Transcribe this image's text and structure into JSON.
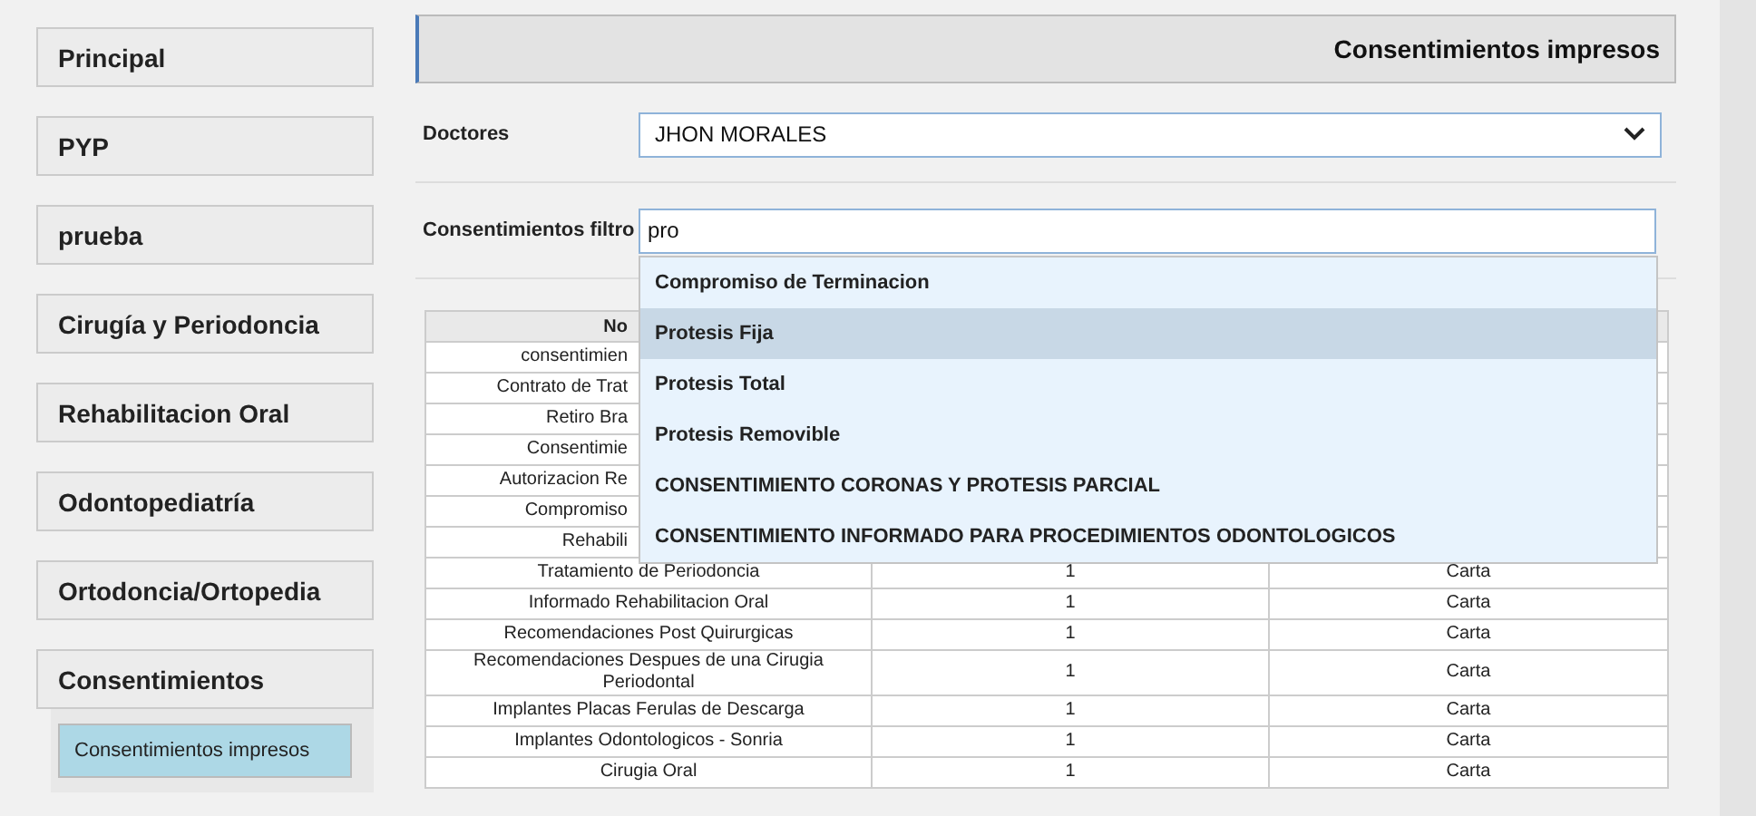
{
  "sidebar": {
    "items": [
      {
        "label": "Principal",
        "selected": false
      },
      {
        "label": "PYP",
        "selected": false
      },
      {
        "label": "prueba",
        "selected": false
      },
      {
        "label": "Cirugía y Periodoncia",
        "selected": false
      },
      {
        "label": "Rehabilitacion Oral",
        "selected": false
      },
      {
        "label": "Odontopediatría",
        "selected": false
      },
      {
        "label": "Ortodoncia/Ortopedia",
        "selected": false
      },
      {
        "label": "Consentimientos",
        "selected": false
      }
    ],
    "subitems": [
      {
        "label": "Consentimientos impresos",
        "selected": true
      }
    ]
  },
  "header": {
    "title": "Consentimientos impresos"
  },
  "form": {
    "doctor": {
      "label": "Doctores",
      "value": "JHON MORALES"
    },
    "filter": {
      "label": "Consentimientos filtro",
      "value": "pro"
    }
  },
  "autocomplete": {
    "items": [
      {
        "label": "Compromiso de Terminacion",
        "selected": false
      },
      {
        "label": "Protesis Fija",
        "selected": true
      },
      {
        "label": "Protesis Total",
        "selected": false
      },
      {
        "label": "Protesis Removible",
        "selected": false
      },
      {
        "label": "CONSENTIMIENTO CORONAS Y PROTESIS PARCIAL",
        "selected": false
      },
      {
        "label": "CONSENTIMIENTO INFORMADO PARA PROCEDIMIENTOS ODONTOLOGICOS",
        "selected": false
      }
    ]
  },
  "table": {
    "columns": [
      "No"
    ],
    "hidden_rows": [
      "consentimien",
      "Contrato de Trat",
      "Retiro Bra",
      "Consentimie",
      "Autorizacion Re",
      "Compromiso",
      "Rehabili"
    ],
    "rows": [
      [
        "Tratamiento de Periodoncia",
        "1",
        "Carta"
      ],
      [
        "Informado Rehabilitacion Oral",
        "1",
        "Carta"
      ],
      [
        "Recomendaciones Post Quirurgicas",
        "1",
        "Carta"
      ],
      [
        "Recomendaciones Despues de una Cirugia Periodontal",
        "1",
        "Carta"
      ],
      [
        "Implantes Placas Ferulas de Descarga",
        "1",
        "Carta"
      ],
      [
        "Implantes Odontologicos - Sonria",
        "1",
        "Carta"
      ],
      [
        "Cirugia Oral",
        "1",
        "Carta"
      ]
    ]
  }
}
